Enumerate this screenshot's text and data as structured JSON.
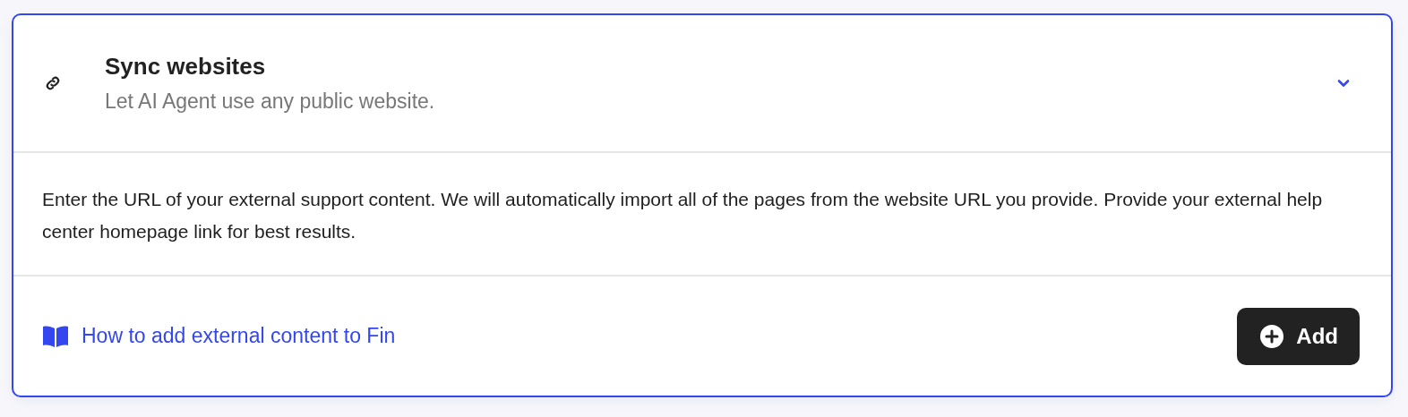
{
  "section": {
    "title": "Sync websites",
    "subtitle": "Let AI Agent use any public website.",
    "expanded": true
  },
  "description": "Enter the URL of your external support content. We will automatically import all of the pages from the website URL you provide. Provide your external help center homepage link for best results.",
  "help_link": "How to add external content to Fin",
  "add_button": "Add"
}
